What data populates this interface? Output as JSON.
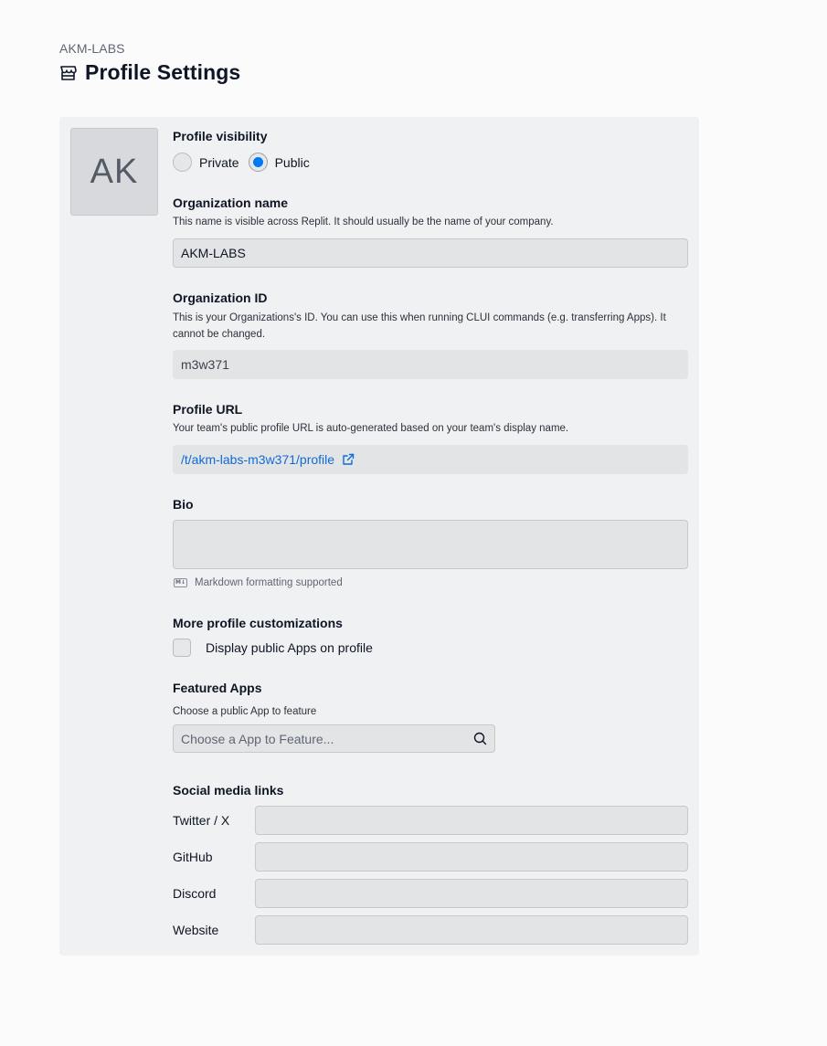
{
  "header": {
    "org": "AKM-LABS",
    "title": "Profile Settings",
    "icon": "storefront-icon"
  },
  "avatar": {
    "initials": "AK"
  },
  "visibility": {
    "label": "Profile visibility",
    "options": [
      "Private",
      "Public"
    ],
    "selected": "Public"
  },
  "org_name": {
    "label": "Organization name",
    "help": "This name is visible across Replit. It should usually be the name of your company.",
    "value": "AKM-LABS"
  },
  "org_id": {
    "label": "Organization ID",
    "help": "This is your Organizations's ID. You can use this when running CLUI commands (e.g. transferring Apps). It cannot be changed.",
    "value": "m3w371"
  },
  "profile_url": {
    "label": "Profile URL",
    "help": "Your team's public profile URL is auto-generated based on your team's display name.",
    "value": "/t/akm-labs-m3w371/profile"
  },
  "bio": {
    "label": "Bio",
    "value": "",
    "markdown_note": "Markdown formatting supported",
    "markdown_badge": "M↓"
  },
  "customizations": {
    "label": "More profile customizations",
    "checkbox_label": "Display public Apps on profile",
    "checked": false
  },
  "featured": {
    "label": "Featured Apps",
    "help": "Choose a public App to feature",
    "placeholder": "Choose a App to Feature..."
  },
  "social": {
    "label": "Social media links",
    "links": [
      {
        "label": "Twitter / X",
        "value": ""
      },
      {
        "label": "GitHub",
        "value": ""
      },
      {
        "label": "Discord",
        "value": ""
      },
      {
        "label": "Website",
        "value": ""
      }
    ]
  },
  "colors": {
    "accent": "#0079f2",
    "link": "#0f6bd6"
  }
}
